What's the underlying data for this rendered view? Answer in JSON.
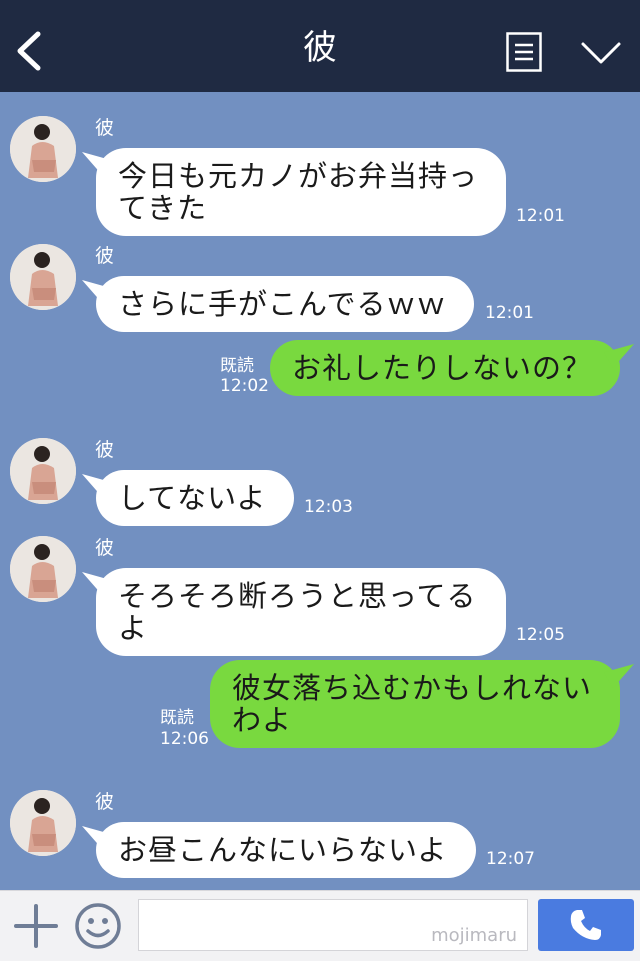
{
  "header": {
    "title": "彼",
    "back_icon": "chevron-left-icon",
    "menu_icon": "list-icon",
    "collapse_icon": "chevron-down-icon"
  },
  "messages": [
    {
      "side": "in",
      "name": "彼",
      "text": "今日も元カノがお弁当持ってきた",
      "time": "12:01"
    },
    {
      "side": "in",
      "name": "彼",
      "text": "さらに手がこんでるｗｗ",
      "time": "12:01"
    },
    {
      "side": "out",
      "read": "既読",
      "text": "お礼したりしないの？",
      "time": "12:02"
    },
    {
      "side": "in",
      "name": "彼",
      "text": "してないよ",
      "time": "12:03"
    },
    {
      "side": "in",
      "name": "彼",
      "text": "そろそろ断ろうと思ってるよ",
      "time": "12:05"
    },
    {
      "side": "out",
      "read": "既読",
      "text": "彼女落ち込むかもしれないわよ",
      "time": "12:06"
    },
    {
      "side": "in",
      "name": "彼",
      "text": "お昼こんなにいらないよ",
      "time": "12:07"
    }
  ],
  "input": {
    "value": "",
    "watermark": "mojimaru",
    "plus_icon": "plus-icon",
    "emoji_icon": "smiley-icon",
    "send_icon": "phone-icon"
  },
  "colors": {
    "background": "#7290c1",
    "header": "#1f2a42",
    "incoming_bubble": "#ffffff",
    "outgoing_bubble": "#79d93f",
    "send_button": "#4a7be0"
  }
}
